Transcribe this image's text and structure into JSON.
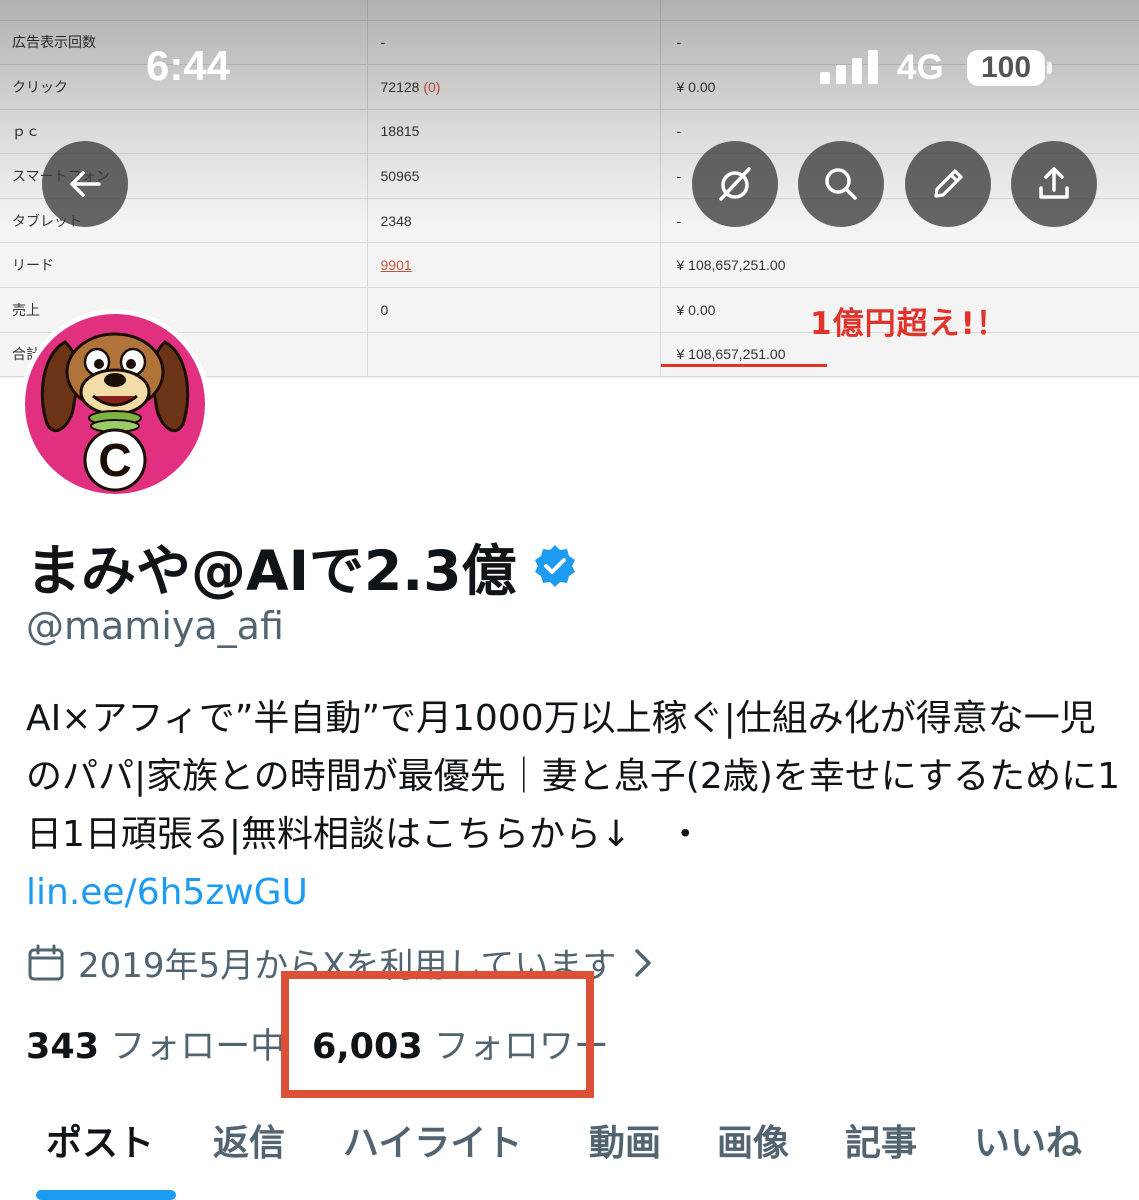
{
  "status_bar": {
    "time": "6:44",
    "network": "4G",
    "battery": "100"
  },
  "banner": {
    "rows": [
      {
        "label": "",
        "value": "",
        "amount": ""
      },
      {
        "label": "広告表示回数",
        "value": "-",
        "amount": "-"
      },
      {
        "label": "クリック",
        "value": "72128",
        "value_sub": "(0)",
        "amount": "¥ 0.00"
      },
      {
        "label": "ｐｃ",
        "value": "18815",
        "amount": "-"
      },
      {
        "label": "スマートフォン",
        "value": "50965",
        "amount": "-"
      },
      {
        "label": "タブレット",
        "value": "2348",
        "amount": "-"
      },
      {
        "label": "リード",
        "value": "9901",
        "amount": "¥ 108,657,251.00"
      },
      {
        "label": "売上",
        "value": "0",
        "amount": "¥ 0.00"
      },
      {
        "label": "合計",
        "value": "",
        "amount": "¥ 108,657,251.00"
      }
    ],
    "annotation": "1億円超え!！"
  },
  "nav": {
    "back_icon": "arrow-left-icon",
    "grok_icon": "grok-icon",
    "search_icon": "search-icon",
    "edit_icon": "pencil-icon",
    "share_icon": "share-icon"
  },
  "profile": {
    "avatar_letter": "C",
    "display_name": "まみや@AIで2.3億",
    "handle": "@mamiya_afi",
    "bio": "AI×アフィで”半自動”で月1000万以上稼ぐ|仕組み化が得意な一児のパパ|家族との時間が最優先｜妻と息子(2歳)を幸せにするために1日1日頑張る|無料相談はこちらから↓　・",
    "bio_link": "lin.ee/6h5zwGU",
    "joined": "2019年5月からXを利用しています",
    "following_count": "343",
    "following_label": "フォロー中",
    "followers_count": "6,003",
    "followers_label": "フォロワー"
  },
  "tabs": [
    {
      "label": "ポスト",
      "active": true
    },
    {
      "label": "返信"
    },
    {
      "label": "ハイライト"
    },
    {
      "label": "動画"
    },
    {
      "label": "画像"
    },
    {
      "label": "記事"
    },
    {
      "label": "いいね"
    }
  ],
  "colors": {
    "accent": "#1d9bf0",
    "highlight_box": "#dc5038",
    "annotation_red": "#e0342a",
    "avatar_bg": "#e0307f"
  }
}
